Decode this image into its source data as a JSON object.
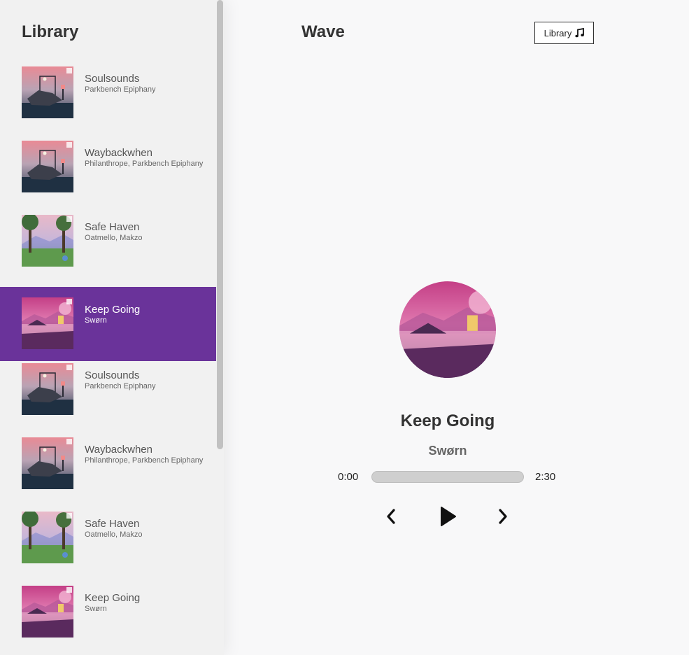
{
  "sidebar": {
    "title": "Library",
    "songs": [
      {
        "name": "Soulsounds",
        "artist": "Parkbench Epiphany",
        "cover": "dusk-room",
        "active": false
      },
      {
        "name": "Waybackwhen",
        "artist": "Philanthrope, Parkbench Epiphany",
        "cover": "dusk-room",
        "active": false
      },
      {
        "name": "Safe Haven",
        "artist": "Oatmello, Makzo",
        "cover": "meadow",
        "active": false
      },
      {
        "name": "Keep Going",
        "artist": "Swørn",
        "cover": "pink-lake",
        "active": true
      },
      {
        "name": "Soulsounds",
        "artist": "Parkbench Epiphany",
        "cover": "dusk-room",
        "active": false
      },
      {
        "name": "Waybackwhen",
        "artist": "Philanthrope, Parkbench Epiphany",
        "cover": "dusk-room",
        "active": false
      },
      {
        "name": "Safe Haven",
        "artist": "Oatmello, Makzo",
        "cover": "meadow",
        "active": false
      },
      {
        "name": "Keep Going",
        "artist": "Swørn",
        "cover": "pink-lake",
        "active": false
      }
    ]
  },
  "header": {
    "title": "Wave",
    "library_button": "Library",
    "library_icon": "music-note-icon"
  },
  "player": {
    "title": "Keep Going",
    "artist": "Swørn",
    "cover": "pink-lake",
    "current_time": "0:00",
    "duration": "2:30",
    "progress": 0,
    "controls": [
      "skip-back-icon",
      "play-icon",
      "skip-forward-icon"
    ]
  },
  "colors": {
    "accent": "#6a339a",
    "background": "#f8f8f9",
    "sidebar": "#f1f1f1"
  }
}
